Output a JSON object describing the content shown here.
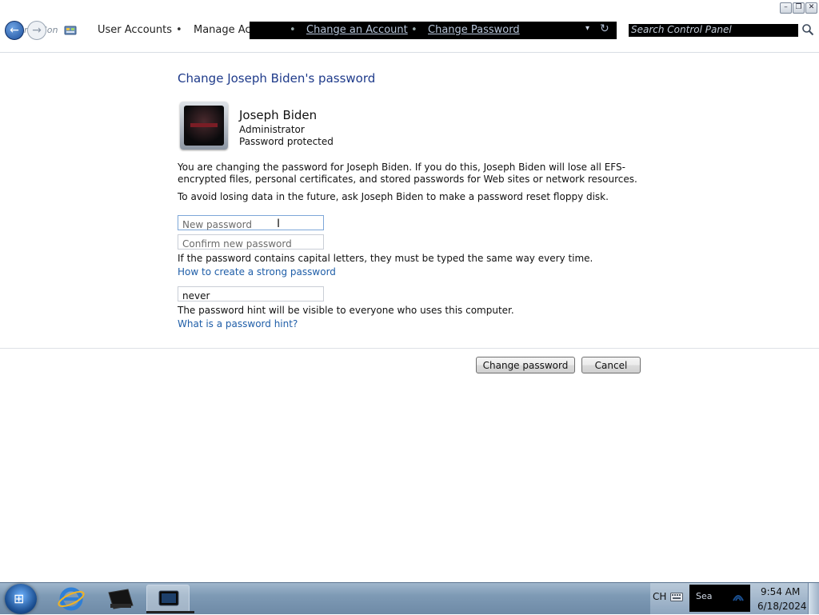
{
  "window": {
    "minimize_glyph": "–",
    "maximize_glyph": "❐",
    "close_glyph": "✕"
  },
  "address_bar": {
    "ghost_text": "rch Con",
    "breadcrumbs": [
      "User Accounts",
      "Manage Accounts",
      "Change an Account",
      "Change Password"
    ],
    "separator": "•",
    "dropdown_glyph": "▾",
    "refresh_glyph": "↻",
    "search_placeholder": "Search Control Panel",
    "back_glyph": "←",
    "forward_glyph": "→"
  },
  "main": {
    "title": "Change Joseph Biden's password",
    "user": {
      "name": "Joseph Biden",
      "role": "Administrator",
      "status": "Password protected"
    },
    "warning": "You are changing the password for Joseph Biden.  If you do this, Joseph Biden will lose all EFS-encrypted files, personal certificates, and stored passwords for Web sites or network resources.",
    "floppy_note": "To avoid losing data in the future, ask Joseph Biden to make a password reset floppy disk.",
    "fields": {
      "new_password_placeholder": "New password",
      "confirm_password_placeholder": "Confirm new password",
      "hint_value": "never"
    },
    "caps_note": "If the password contains capital letters, they must be typed the same way every time.",
    "strong_link": "How to create a strong password",
    "hint_note": "The password hint will be visible to everyone who uses this computer.",
    "hint_link": "What is a password hint?",
    "buttons": {
      "change": "Change password",
      "cancel": "Cancel"
    }
  },
  "taskbar": {
    "start_glyph": "⊞",
    "language": "CH",
    "notification_text": "Sea",
    "time": "9:54 AM",
    "date": "6/18/2024",
    "pinned": [
      "internet-explorer-icon",
      "windows-explorer-icon",
      "control-panel-icon"
    ]
  },
  "colors": {
    "title_blue": "#1e3a8a",
    "link_blue": "#1f5ea8",
    "taskbar": "#7e9ab5"
  }
}
